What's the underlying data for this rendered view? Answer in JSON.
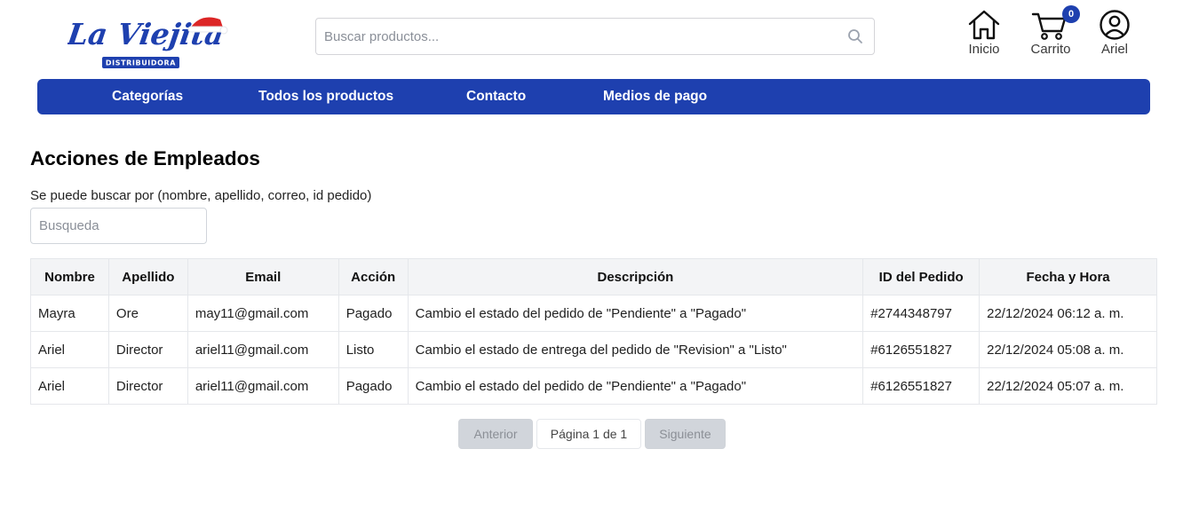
{
  "brand": {
    "name": "La Viejita",
    "tagline": "DISTRIBUIDORA",
    "colors": {
      "primary": "#1e40af",
      "hat_red": "#dc2626"
    }
  },
  "search": {
    "placeholder": "Buscar productos...",
    "value": ""
  },
  "header": {
    "home_label": "Inicio",
    "cart_label": "Carrito",
    "cart_count": "0",
    "user_label": "Ariel"
  },
  "nav": {
    "items": [
      {
        "label": "Categorías"
      },
      {
        "label": "Todos los productos"
      },
      {
        "label": "Contacto"
      },
      {
        "label": "Medios de pago"
      }
    ]
  },
  "main": {
    "title": "Acciones de Empleados",
    "hint": "Se puede buscar por (nombre, apellido, correo, id pedido)",
    "filter_placeholder": "Busqueda",
    "filter_value": ""
  },
  "table": {
    "headers": [
      "Nombre",
      "Apellido",
      "Email",
      "Acción",
      "Descripción",
      "ID del Pedido",
      "Fecha y Hora"
    ],
    "rows": [
      [
        "Mayra",
        "Ore",
        "may11@gmail.com",
        "Pagado",
        "Cambio el estado del pedido de \"Pendiente\" a \"Pagado\"",
        "#2744348797",
        "22/12/2024 06:12 a. m."
      ],
      [
        "Ariel",
        "Director",
        "ariel11@gmail.com",
        "Listo",
        "Cambio el estado de entrega del pedido de \"Revision\" a \"Listo\"",
        "#6126551827",
        "22/12/2024 05:08 a. m."
      ],
      [
        "Ariel",
        "Director",
        "ariel11@gmail.com",
        "Pagado",
        "Cambio el estado del pedido de \"Pendiente\" a \"Pagado\"",
        "#6126551827",
        "22/12/2024 05:07 a. m."
      ]
    ]
  },
  "pagination": {
    "prev_label": "Anterior",
    "page_label": "Página 1 de 1",
    "next_label": "Siguiente"
  }
}
